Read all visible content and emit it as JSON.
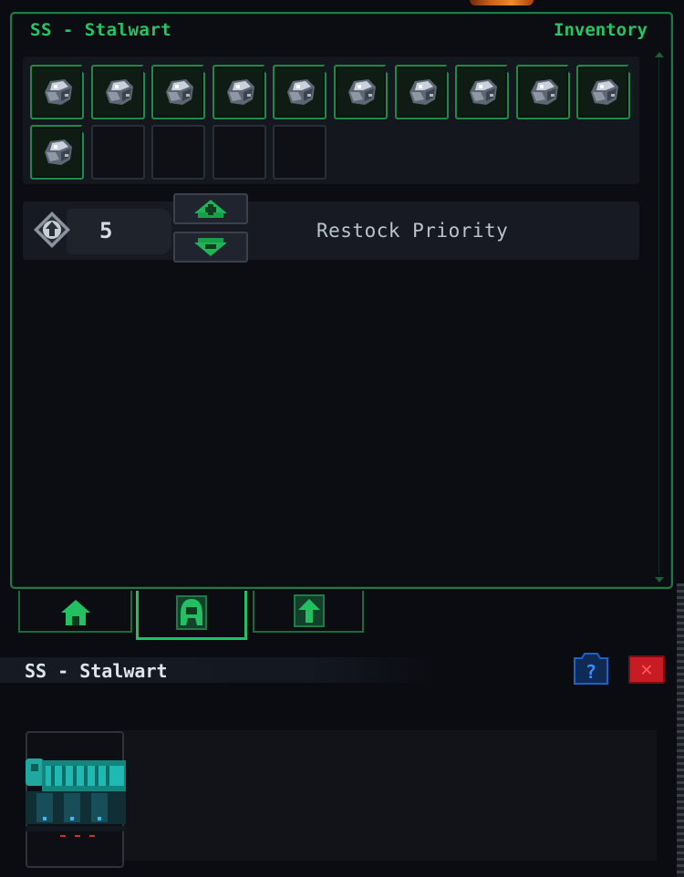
{
  "panel": {
    "title": "SS - Stalwart",
    "tab_label": "Inventory"
  },
  "inventory": {
    "total_slots": 15,
    "filled_slots": 11,
    "item_icon": "ore-chunk-icon"
  },
  "restock": {
    "value": "5",
    "label": "Restock Priority",
    "increase_icon": "plus-arrow-up-icon",
    "decrease_icon": "minus-arrow-down-icon",
    "priority_icon": "priority-arrow-icon"
  },
  "tabs": [
    {
      "name": "home",
      "icon": "home-icon",
      "active": false
    },
    {
      "name": "crew",
      "icon": "crew-helmet-icon",
      "active": true
    },
    {
      "name": "transfer",
      "icon": "upload-arrow-icon",
      "active": false
    }
  ],
  "ship": {
    "name": "SS - Stalwart",
    "help_icon": "help-icon",
    "close_label": "✕"
  },
  "colors": {
    "accent_green": "#27c463",
    "border_green": "#1f7a45",
    "close_red": "#c71c24",
    "help_blue": "#1d63c7"
  }
}
